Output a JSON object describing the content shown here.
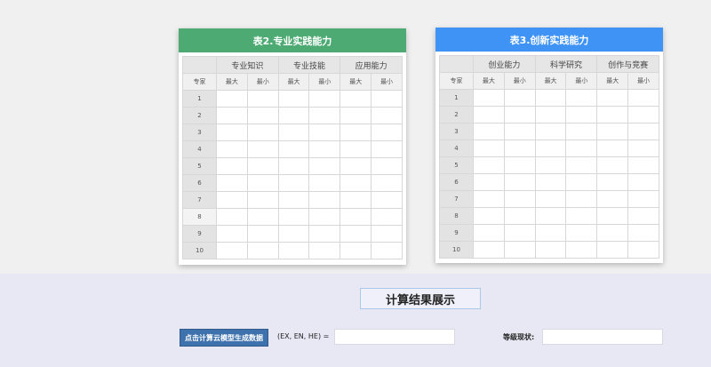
{
  "table2": {
    "title": "表2.专业实践能力",
    "groups": [
      "专业知识",
      "专业技能",
      "应用能力"
    ],
    "expert_label": "专家",
    "max_label": "最大",
    "min_label": "最小",
    "rows": [
      "1",
      "2",
      "3",
      "4",
      "5",
      "6",
      "7",
      "8",
      "9",
      "10"
    ]
  },
  "table3": {
    "title": "表3.创新实践能力",
    "groups": [
      "创业能力",
      "科学研究",
      "创作与竞赛"
    ],
    "expert_label": "专家",
    "max_label": "最大",
    "min_label": "最小",
    "rows": [
      "1",
      "2",
      "3",
      "4",
      "5",
      "6",
      "7",
      "8",
      "9",
      "10"
    ]
  },
  "result": {
    "title": "计算结果展示",
    "calc_button": "点击计算云模型生成数据",
    "formula_label": "(EX, EN, HE) =",
    "formula_value": "",
    "level_label": "等级现状:",
    "level_value": ""
  },
  "colors": {
    "table2_header": "#4caa72",
    "table3_header": "#3f93f5",
    "button": "#3e72ad"
  }
}
